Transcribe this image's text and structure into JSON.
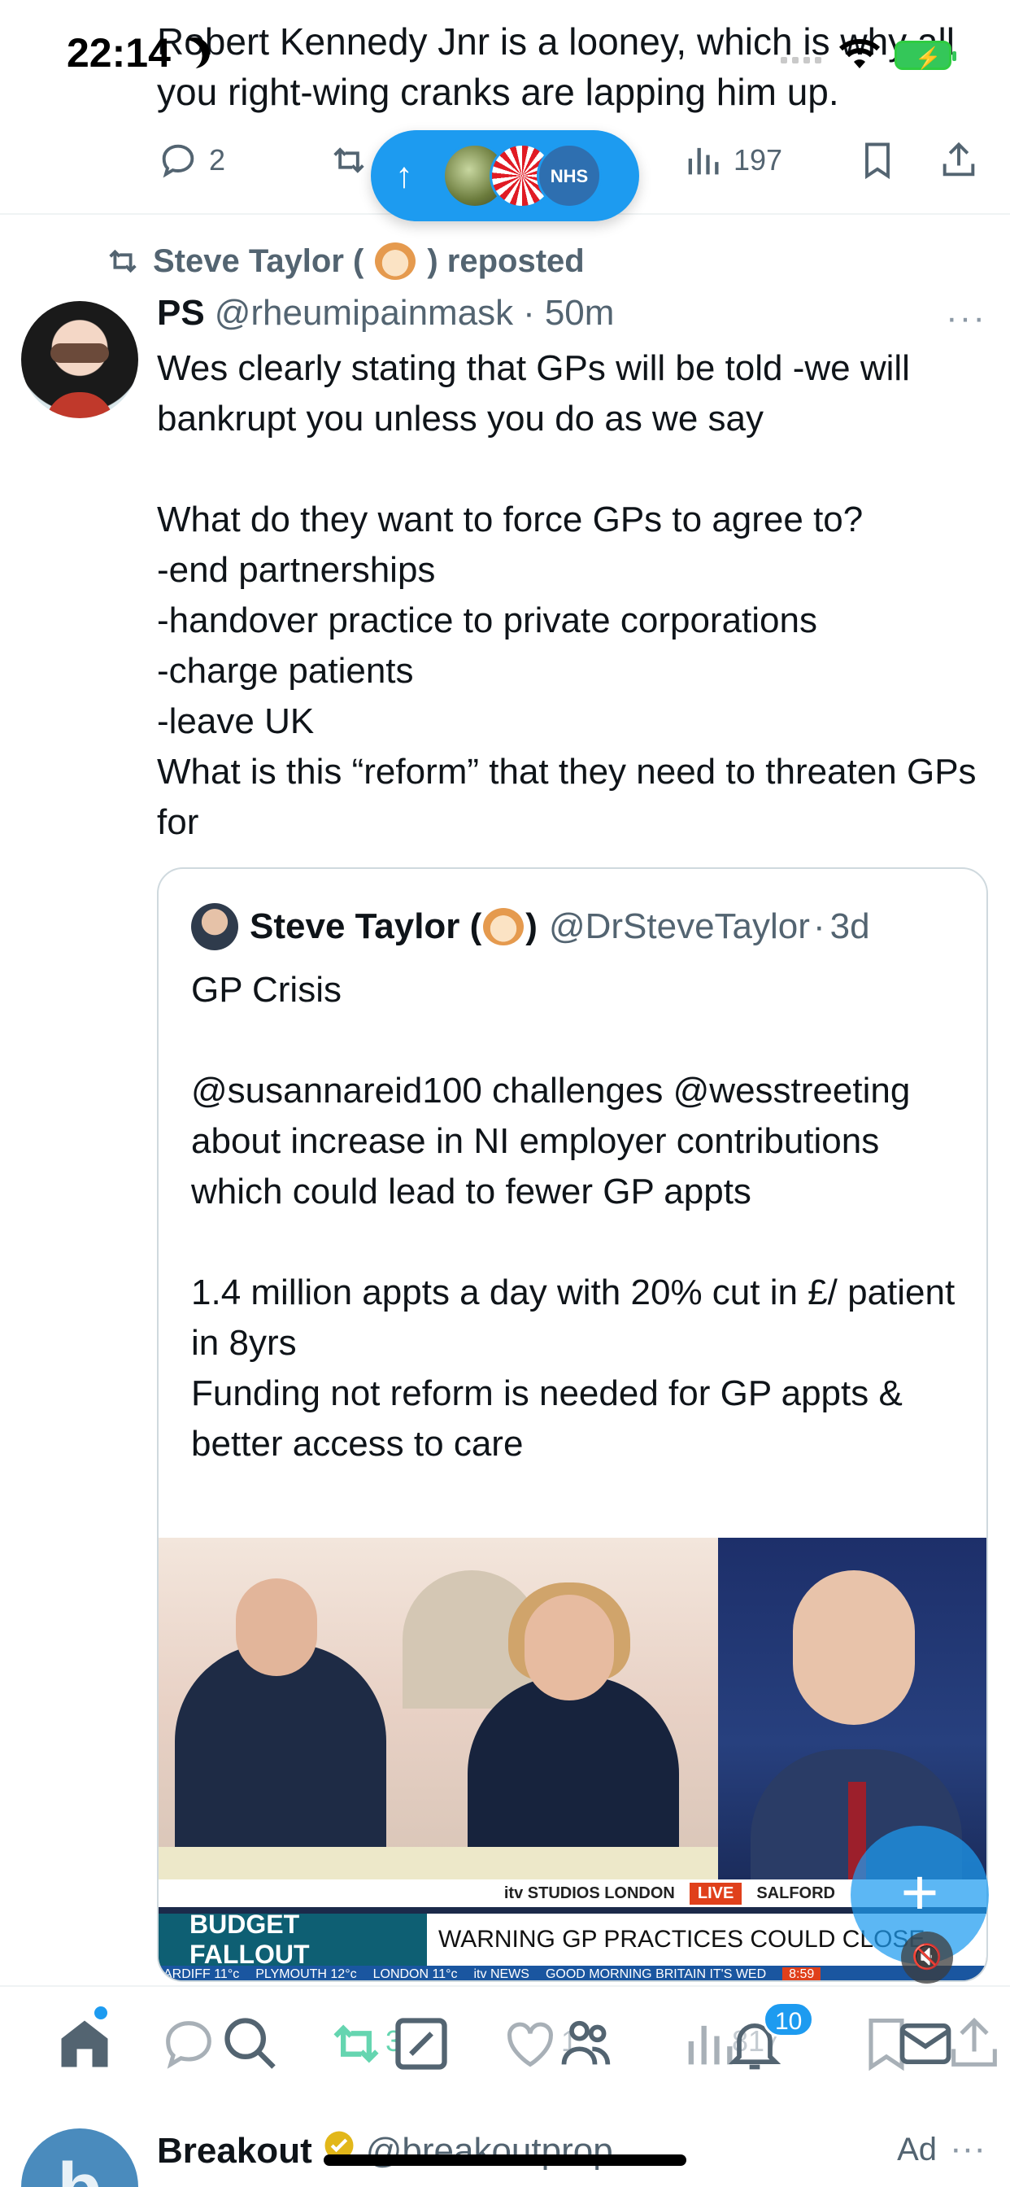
{
  "status_bar": {
    "time": "22:14"
  },
  "top_tweet": {
    "text": "Robert Kennedy Jnr is a looney, which is why all you right-wing cranks are lapping him up.",
    "replies": "2",
    "views": "197"
  },
  "new_posts_pill": {
    "arrow": "↑",
    "avatar3_text": "NHS"
  },
  "repost": {
    "label_pre": "Steve Taylor (",
    "label_post": ") reposted"
  },
  "main_tweet": {
    "name": "PS",
    "handle": "@rheumipainmask",
    "separator": "·",
    "time": "50m",
    "more": "···",
    "body": "Wes clearly stating that GPs will be told -we will bankrupt you unless you do as we say\n\nWhat do they want to force GPs to agree to?\n-end partnerships\n-handover practice to private corporations\n-charge patients\n-leave UK\nWhat is this “reform” that they need to threaten GPs for"
  },
  "quote": {
    "name_pre": "Steve Taylor (",
    "name_post": ")",
    "handle": "@DrSteveTaylor",
    "separator": "·",
    "time": "3d",
    "body": "GP Crisis\n\n@susannareid100 challenges @wesstreeting about increase in NI employer contributions which could lead to fewer GP appts\n\n1.4 million appts a day with 20% cut in £/ patient in 8yrs\nFunding not reform is needed for GP appts & better access to care",
    "media": {
      "strip_location": "itv STUDIOS LONDON",
      "strip_live": "LIVE",
      "strip_right": "SALFORD",
      "banner_left": "BUDGET FALLOUT",
      "banner_right": "WARNING GP PRACTICES COULD CLOSE",
      "ticker": [
        "ARDIFF 11°c",
        "PLYMOUTH 12°c",
        "LONDON 11°c",
        "itv NEWS",
        "GOOD MORNING BRITAIN IT'S WED",
        "8:59"
      ]
    }
  },
  "fab": {
    "label": "+"
  },
  "bottom_nav": {
    "ghost_retweets": "3",
    "ghost_likes": "1",
    "ghost_views": "817",
    "notifications_badge": "10"
  },
  "ad_tweet": {
    "name": "Breakout",
    "handle": "@breakoutprop",
    "label": "Ad",
    "more": "···",
    "avatar_letter": "b"
  },
  "colors": {
    "accent": "#1d9bf0",
    "text": "#0f1419",
    "secondary": "#536471",
    "repost_green": "#00ba7c"
  },
  "icons": [
    "moon-icon",
    "wifi-icon",
    "battery-icon",
    "reply-icon",
    "retweet-icon",
    "views-icon",
    "bookmark-icon",
    "share-icon",
    "home-icon",
    "search-icon",
    "compose-icon",
    "communities-icon",
    "notifications-icon",
    "messages-icon",
    "mute-icon",
    "verified-icon"
  ]
}
